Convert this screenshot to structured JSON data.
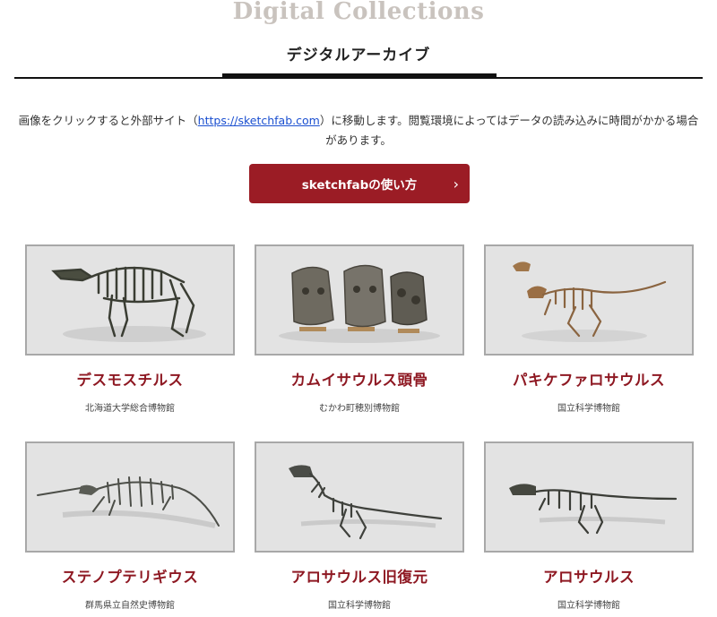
{
  "header": {
    "title_en": "Digital Collections",
    "title_jp": "デジタルアーカイブ"
  },
  "intro": {
    "text_before": "画像をクリックすると外部サイト（",
    "link_text": "https://sketchfab.com",
    "text_after": "）に移動します。閲覧環境によってはデータの読み込みに時間がかかる場合があります。"
  },
  "cta": {
    "label": "sketchfabの使い方",
    "icon": "chevron-right-icon"
  },
  "colors": {
    "accent": "#9b1c25",
    "title_red": "#8e1822",
    "thumb_bg": "#e3e3e3"
  },
  "cards": [
    {
      "title": "デスモスチルス",
      "museum": "北海道大学総合博物館",
      "image": "desmostylus-skeleton"
    },
    {
      "title": "カムイサウルス頭骨",
      "museum": "むかわ町穂別博物館",
      "image": "kamuysaurus-skull"
    },
    {
      "title": "パキケファロサウルス",
      "museum": "国立科学博物館",
      "image": "pachycephalosaurus-skeleton"
    },
    {
      "title": "ステノプテリギウス",
      "museum": "群馬県立自然史博物館",
      "image": "stenopterygius-skeleton"
    },
    {
      "title": "アロサウルス旧復元",
      "museum": "国立科学博物館",
      "image": "allosaurus-old-skeleton"
    },
    {
      "title": "アロサウルス",
      "museum": "国立科学博物館",
      "image": "allosaurus-skeleton"
    }
  ]
}
